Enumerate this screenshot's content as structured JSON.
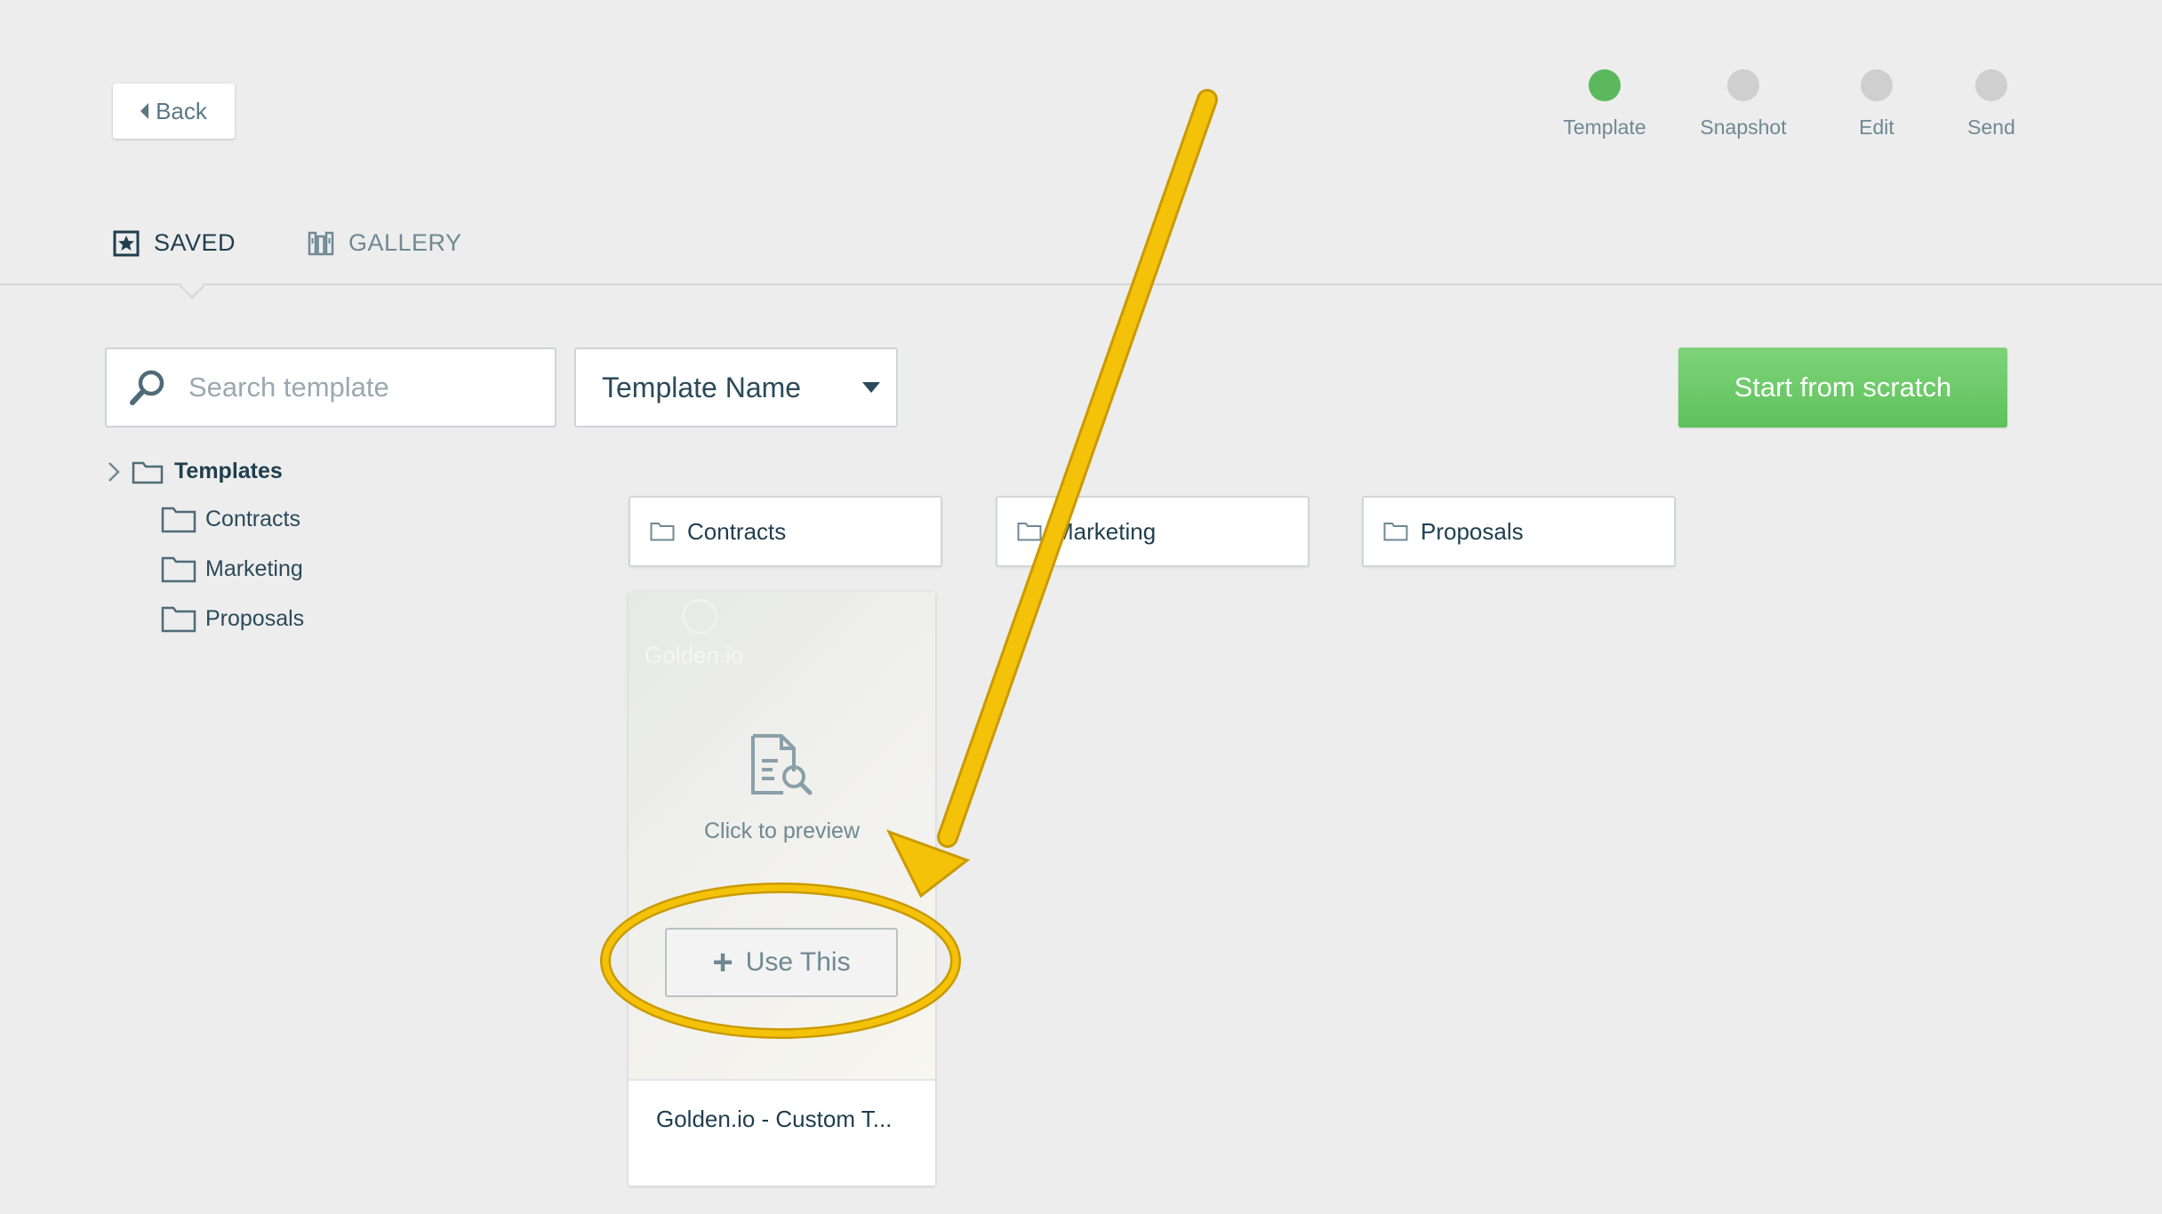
{
  "header": {
    "back_label": "Back"
  },
  "stepper": {
    "steps": [
      {
        "label": "Template",
        "active": true
      },
      {
        "label": "Snapshot",
        "active": false
      },
      {
        "label": "Edit",
        "active": false
      },
      {
        "label": "Send",
        "active": false
      }
    ]
  },
  "tabs": {
    "saved": "SAVED",
    "gallery": "GALLERY"
  },
  "toolbar": {
    "search_placeholder": "Search template",
    "sort_value": "Template Name",
    "start_from_scratch": "Start from scratch"
  },
  "tree": {
    "root": "Templates",
    "children": [
      "Contracts",
      "Marketing",
      "Proposals"
    ]
  },
  "folders": [
    "Contracts",
    "Marketing",
    "Proposals"
  ],
  "template_card": {
    "brand": "Golden.io",
    "preview_text": "Click to preview",
    "use_label": "Use This",
    "name": "Golden.io - Custom T..."
  },
  "colors": {
    "accent_green": "#5cb85c",
    "annotation_yellow": "#f5c20a",
    "background": "#ededed"
  }
}
